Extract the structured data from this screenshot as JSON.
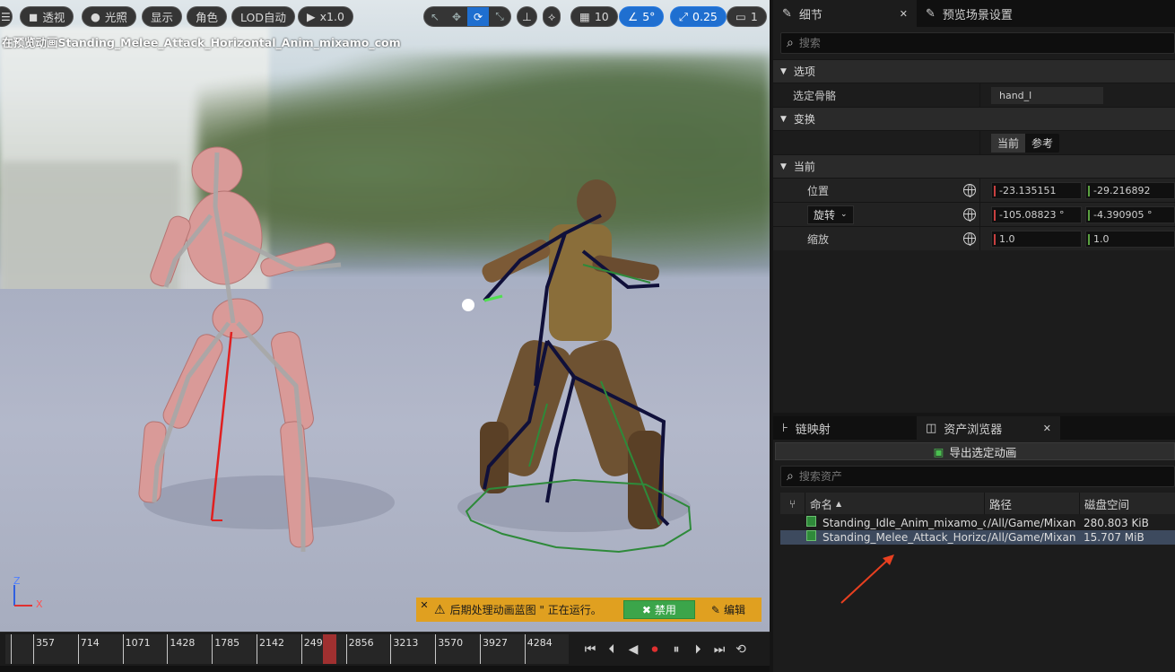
{
  "viewport": {
    "toolbar": {
      "menu_icon": "hamburger-icon",
      "perspective": "透视",
      "lighting": "光照",
      "show": "显示",
      "character": "角色",
      "lod": "LOD自动",
      "play_speed": "x1.0",
      "grid_snap": "10",
      "angle_snap": "5°",
      "scale_snap": "0.25",
      "camera_speed": "1"
    },
    "preview_title": "在预览动画Standing_Melee_Attack_Horizontal_Anim_mixamo_com",
    "axis": {
      "z": "Z",
      "x": "X"
    },
    "warning": {
      "text": "后期处理动画蓝图 \" 正在运行。",
      "disable": "禁用",
      "edit": "编辑"
    }
  },
  "timeline": {
    "ticks": [
      "357",
      "714",
      "1071",
      "1428",
      "1785",
      "2142",
      "2499",
      "2856",
      "3213",
      "3570",
      "3927",
      "4284"
    ],
    "transport": [
      "skip-to-start-icon",
      "step-back-icon",
      "play-reverse-icon",
      "record-icon",
      "pause-icon",
      "step-forward-icon",
      "skip-to-end-icon",
      "loop-icon"
    ]
  },
  "details": {
    "tab_details": "细节",
    "tab_preview": "预览场景设置",
    "search_placeholder": "搜索",
    "section_options": "选项",
    "selected_bone_label": "选定骨骼",
    "selected_bone_value": "hand_l",
    "section_transform": "变换",
    "toggle_current": "当前",
    "toggle_reference": "参考",
    "section_current": "当前",
    "location_label": "位置",
    "location_x": "-23.135151",
    "location_y": "-29.216892",
    "rotation_label": "旋转",
    "rotation_x": "-105.08823 °",
    "rotation_y": "-4.390905 °",
    "scale_label": "缩放",
    "scale_x": "1.0",
    "scale_y": "1.0"
  },
  "assets": {
    "tab_retarget": "链映射",
    "tab_browser": "资产浏览器",
    "export_button": "导出选定动画",
    "search_placeholder": "搜索资产",
    "columns": {
      "name": "命名",
      "path": "路径",
      "size": "磁盘空间"
    },
    "rows": [
      {
        "name": "Standing_Idle_Anim_mixamo_c",
        "path": "/All/Game/Mixan",
        "size": "280.803 KiB"
      },
      {
        "name": "Standing_Melee_Attack_Horizo",
        "path": "/All/Game/Mixan",
        "size": "15.707 MiB"
      }
    ]
  }
}
